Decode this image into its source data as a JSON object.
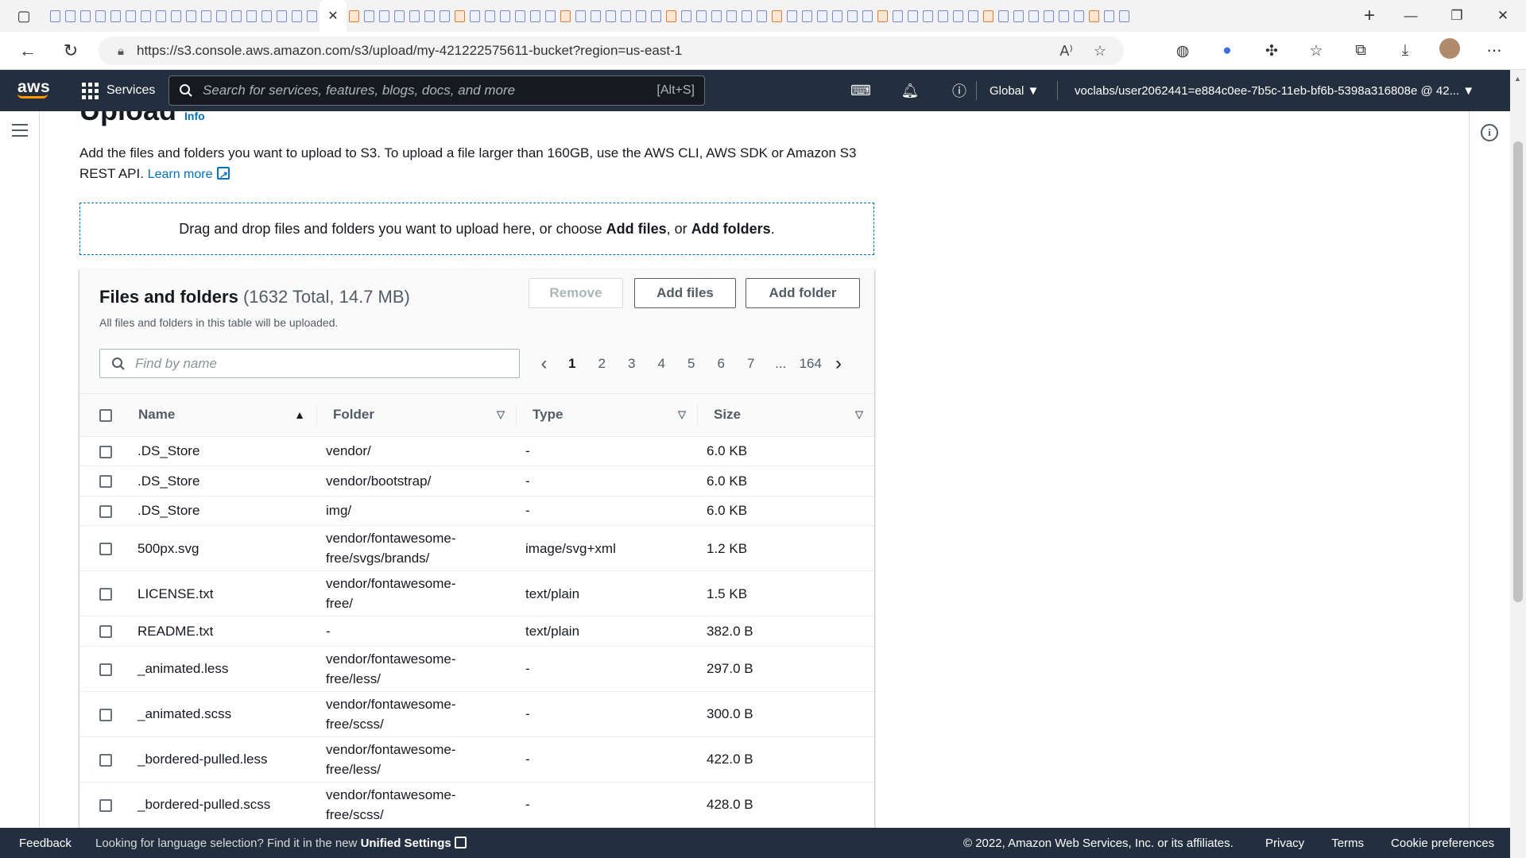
{
  "browser": {
    "url": "https://s3.console.aws.amazon.com/s3/upload/my-421222575611-bucket?region=us-east-1"
  },
  "aws_nav": {
    "logo": "aws",
    "services_label": "Services",
    "search_placeholder": "Search for services, features, blogs, docs, and more",
    "search_shortcut": "[Alt+S]",
    "region": "Global ▼",
    "account": "voclabs/user2062441=e884c0ee-7b5c-11eb-bf6b-5398a316808e @ 42... ▼"
  },
  "page": {
    "heading": "Upload",
    "info_link": "Info",
    "description": "Add the files and folders you want to upload to S3. To upload a file larger than 160GB, use the AWS CLI, AWS SDK or Amazon S3 REST API.",
    "learn_more": "Learn more",
    "dropzone_prefix": "Drag and drop files and folders you want to upload here, or choose ",
    "dropzone_add_files": "Add files",
    "dropzone_mid": ", or ",
    "dropzone_add_folders": "Add folders",
    "dropzone_suffix": "."
  },
  "files_panel": {
    "title": "Files and folders",
    "count": "(1632 Total, 14.7 MB)",
    "subtitle": "All files and folders in this table will be uploaded.",
    "remove_label": "Remove",
    "add_files_label": "Add files",
    "add_folder_label": "Add folder",
    "find_placeholder": "Find by name",
    "pagination": {
      "pages": [
        "1",
        "2",
        "3",
        "4",
        "5",
        "6",
        "7",
        "...",
        "164"
      ],
      "current": "1"
    },
    "columns": [
      "Name",
      "Folder",
      "Type",
      "Size"
    ],
    "rows": [
      {
        "name": ".DS_Store",
        "folder": "vendor/",
        "type": "-",
        "size": "6.0 KB"
      },
      {
        "name": ".DS_Store",
        "folder": "vendor/bootstrap/",
        "type": "-",
        "size": "6.0 KB"
      },
      {
        "name": ".DS_Store",
        "folder": "img/",
        "type": "-",
        "size": "6.0 KB"
      },
      {
        "name": "500px.svg",
        "folder": "vendor/fontawesome-free/svgs/brands/",
        "type": "image/svg+xml",
        "size": "1.2 KB"
      },
      {
        "name": "LICENSE.txt",
        "folder": "vendor/fontawesome-free/",
        "type": "text/plain",
        "size": "1.5 KB"
      },
      {
        "name": "README.txt",
        "folder": "-",
        "type": "text/plain",
        "size": "382.0 B"
      },
      {
        "name": "_animated.less",
        "folder": "vendor/fontawesome-free/less/",
        "type": "-",
        "size": "297.0 B"
      },
      {
        "name": "_animated.scss",
        "folder": "vendor/fontawesome-free/scss/",
        "type": "-",
        "size": "300.0 B"
      },
      {
        "name": "_bordered-pulled.less",
        "folder": "vendor/fontawesome-free/less/",
        "type": "-",
        "size": "422.0 B"
      },
      {
        "name": "_bordered-pulled.scss",
        "folder": "vendor/fontawesome-free/scss/",
        "type": "-",
        "size": "428.0 B"
      }
    ]
  },
  "footer": {
    "feedback": "Feedback",
    "language_prefix": "Looking for language selection? Find it in the new ",
    "unified_settings": "Unified Settings",
    "copyright": "© 2022, Amazon Web Services, Inc. or its affiliates.",
    "privacy": "Privacy",
    "terms": "Terms",
    "cookie": "Cookie preferences"
  },
  "colors": {
    "aws_nav_bg": "#232f3e",
    "link_blue": "#0073bb",
    "aws_orange": "#ff9900"
  }
}
